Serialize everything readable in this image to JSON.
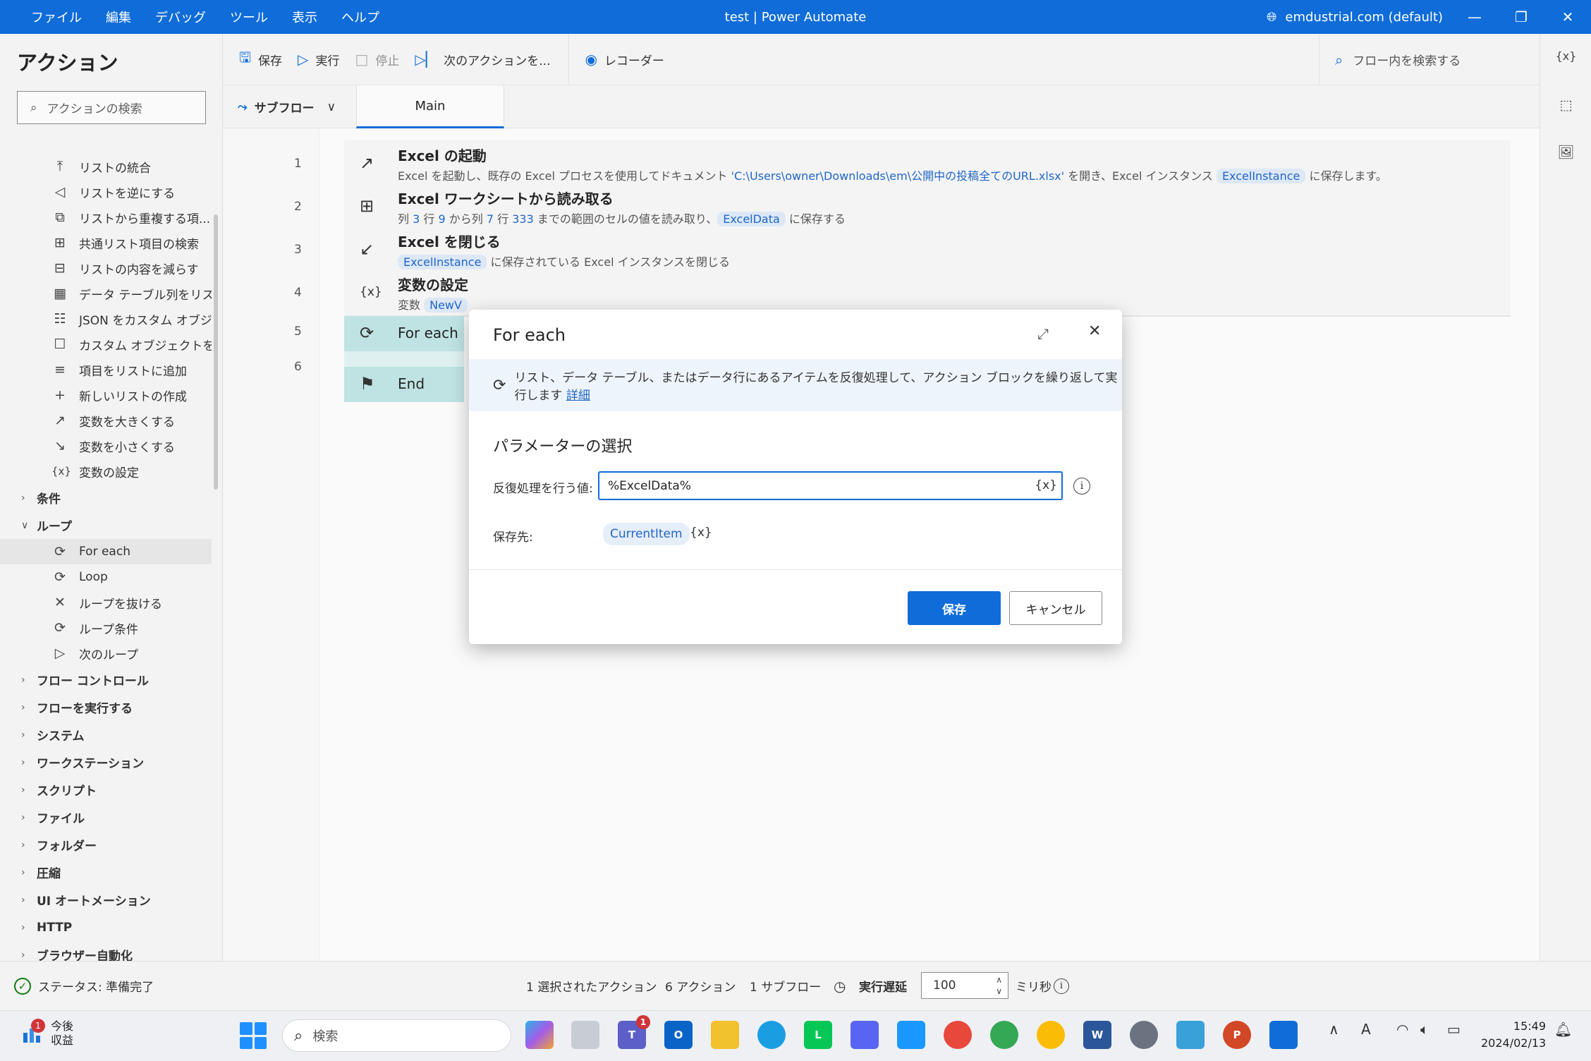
{
  "titlebar": {
    "menu": [
      "ファイル",
      "編集",
      "デバッグ",
      "ツール",
      "表示",
      "ヘルプ"
    ],
    "title": "test | Power Automate",
    "account": "emdustrial.com (default)"
  },
  "left_panel": {
    "title": "アクション",
    "search_placeholder": "アクションの検索",
    "items": [
      {
        "icon": "merge-lists-icon",
        "label": "リストの統合"
      },
      {
        "icon": "reverse-list-icon",
        "label": "リストを逆にする"
      },
      {
        "icon": "remove-duplicates-icon",
        "label": "リストから重複する項..."
      },
      {
        "icon": "common-items-icon",
        "label": "共通リスト項目の検索"
      },
      {
        "icon": "subtract-list-icon",
        "label": "リストの内容を減らす"
      },
      {
        "icon": "datatable-column-icon",
        "label": "データ テーブル列をリス..."
      },
      {
        "icon": "json-icon",
        "label": "JSON をカスタム オブジ..."
      },
      {
        "icon": "custom-object-icon",
        "label": "カスタム オブジェクトを J..."
      },
      {
        "icon": "add-item-icon",
        "label": "項目をリストに追加"
      },
      {
        "icon": "new-list-icon",
        "label": "新しいリストの作成"
      },
      {
        "icon": "increase-icon",
        "label": "変数を大きくする"
      },
      {
        "icon": "decrease-icon",
        "label": "変数を小さくする"
      },
      {
        "icon": "variable-icon",
        "label": "変数の設定"
      }
    ],
    "cat_conditions": "条件",
    "cat_loop": "ループ",
    "loop_items": [
      {
        "icon": "foreach-icon",
        "label": "For each"
      },
      {
        "icon": "loop-icon",
        "label": "Loop"
      },
      {
        "icon": "exit-loop-icon",
        "label": "ループを抜ける"
      },
      {
        "icon": "loop-condition-icon",
        "label": "ループ条件"
      },
      {
        "icon": "next-loop-icon",
        "label": "次のループ"
      }
    ],
    "categories": [
      "フロー コントロール",
      "フローを実行する",
      "システム",
      "ワークステーション",
      "スクリプト",
      "ファイル",
      "フォルダー",
      "圧縮",
      "UI オートメーション",
      "HTTP",
      "ブラウザー自動化"
    ]
  },
  "toolbar": {
    "save": "保存",
    "run": "実行",
    "stop": "停止",
    "next_action": "次のアクションを...",
    "recorder": "レコーダー",
    "search_flow": "フロー内を検索する"
  },
  "tabs": {
    "subflow": "サブフロー",
    "main": "Main"
  },
  "actions": {
    "a1": {
      "num": "1",
      "title": "Excel の起動",
      "d1": "Excel を起動し、既存の Excel プロセスを使用してドキュメント ",
      "path": "'C:\\Users\\owner\\Downloads\\em\\公開中の投稿全てのURL.xlsx'",
      "d2": " を開き、Excel インスタンス ",
      "var": "ExcelInstance",
      "d3": " に保存します。"
    },
    "a2": {
      "num": "2",
      "title": "Excel ワークシートから読み取る",
      "d1": "列 ",
      "v1": "3",
      "d2": " 行 ",
      "v2": "9",
      "d3": " から列 ",
      "v3": "7",
      "d4": " 行 ",
      "v4": "333",
      "d5": " までの範囲のセルの値を読み取り、",
      "var": "ExcelData",
      "d6": " に保存する"
    },
    "a3": {
      "num": "3",
      "title": "Excel を閉じる",
      "var": "ExcelInstance",
      "d1": " に保存されている Excel インスタンスを閉じる"
    },
    "a4": {
      "num": "4",
      "title": "変数の設定",
      "d1": "変数 ",
      "var": "NewV"
    },
    "a5": {
      "num": "5",
      "title": "For each"
    },
    "a6": {
      "num": "6",
      "title": "End"
    }
  },
  "dialog": {
    "title": "For each",
    "info": "リスト、データ テーブル、またはデータ行にあるアイテムを反復処理して、アクション ブロックを繰り返して実行します",
    "info_link": "詳細",
    "section": "パラメーターの選択",
    "iterate_label": "反復処理を行う値:",
    "iterate_value": "%ExcelData%",
    "var_symbol": "{x}",
    "save_to_label": "保存先:",
    "save_to_value": "CurrentItem",
    "save_button": "保存",
    "cancel_button": "キャンセル"
  },
  "statusbar": {
    "status": "ステータス: 準備完了",
    "selected": "1 選択されたアクション",
    "actions_count": "6 アクション",
    "subflows": "1 サブフロー",
    "delay_label": "実行遅延",
    "delay_value": "100",
    "unit": "ミリ秒"
  },
  "taskbar": {
    "weather_badge": "1",
    "weather_line1": "今後",
    "weather_line2": "収益",
    "search": "検索",
    "teams_badge": "1",
    "time": "15:49",
    "date": "2024/02/13"
  },
  "colors": {
    "accent": "#0f6cd9",
    "block": "#bfe3e3",
    "variable_chip": "#dde8f7"
  }
}
